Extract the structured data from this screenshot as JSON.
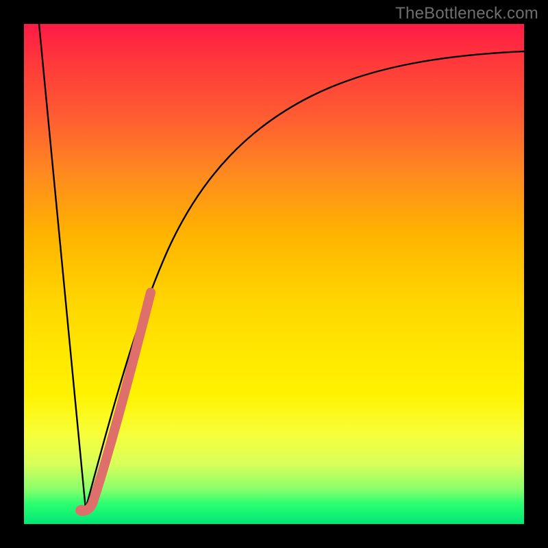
{
  "watermark": "TheBottleneck.com",
  "colors": {
    "frame": "#000000",
    "curve": "#000000",
    "highlight": "#de6f6a",
    "gradient_top": "#ff1a47",
    "gradient_bottom": "#00e676"
  },
  "chart_data": {
    "type": "line",
    "title": "",
    "xlabel": "",
    "ylabel": "",
    "xlim": [
      0,
      100
    ],
    "ylim": [
      0,
      100
    ],
    "grid": false,
    "legend": false,
    "series": [
      {
        "name": "descending-left-branch",
        "x": [
          3,
          12
        ],
        "y": [
          100,
          3
        ]
      },
      {
        "name": "ascending-right-branch",
        "x": [
          12,
          15,
          18,
          22,
          26,
          30,
          35,
          40,
          46,
          52,
          58,
          64,
          70,
          76,
          82,
          88,
          94,
          100
        ],
        "y": [
          3,
          16,
          28,
          40,
          50,
          58,
          65,
          71,
          76,
          80,
          83,
          86,
          88,
          90,
          91,
          92,
          93,
          94
        ]
      }
    ],
    "annotations": [
      {
        "name": "pink-highlight-segment",
        "style": "thick-rounded",
        "color": "#de6f6a",
        "x": [
          12,
          14,
          18,
          22,
          25
        ],
        "y": [
          3,
          6,
          22,
          37,
          48
        ]
      }
    ]
  }
}
